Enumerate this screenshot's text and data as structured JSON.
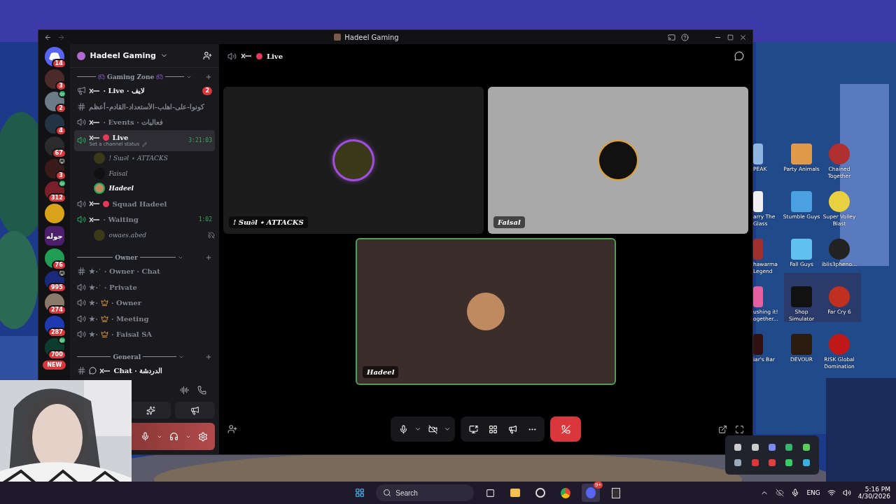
{
  "window": {
    "title": "Hadeel Gaming"
  },
  "servers": [
    {
      "kind": "home",
      "badge": "14"
    },
    {
      "kind": "avatar",
      "badge": "3"
    },
    {
      "kind": "avatar",
      "badge": "2",
      "in_voice": true
    },
    {
      "kind": "avatar",
      "badge": "4"
    },
    {
      "kind": "avatar",
      "badge": "67"
    },
    {
      "kind": "avatar",
      "badge": "3",
      "streaming": true
    },
    {
      "kind": "avatar",
      "badge": "312",
      "in_voice": true
    },
    {
      "kind": "avatar"
    },
    {
      "kind": "logo",
      "label": "جوله"
    },
    {
      "kind": "avatar",
      "badge": "76"
    },
    {
      "kind": "avatar",
      "badge": "995",
      "streaming": true
    },
    {
      "kind": "avatar",
      "badge": "274"
    },
    {
      "kind": "avatar",
      "badge": "287"
    },
    {
      "kind": "avatar",
      "badge": "700",
      "in_voice": true
    }
  ],
  "new_badge": "NEW",
  "sidebar": {
    "server_name": "Hadeel Gaming",
    "categories": [
      {
        "name": "Gaming Zone",
        "gamepads": true,
        "channels": [
          {
            "kind": "announcement",
            "ornament": true,
            "name": "· Live · لايف",
            "unread": true,
            "badge": "2",
            "selected": false
          },
          {
            "kind": "text",
            "name": "كونوا-على-اهلب-الأستعداد-القادم-أعظم",
            "unread": false,
            "selected": false
          },
          {
            "kind": "voice",
            "ornament": true,
            "name": "· Events · فعاليات",
            "unread": false,
            "selected": false
          },
          {
            "kind": "voice",
            "ornament": true,
            "live_dot": true,
            "name": "Live",
            "unread": true,
            "selected": true,
            "active": true,
            "timer": "3:21:03",
            "status": "Set a channel status",
            "users": [
              {
                "name": "! Sɯ∂l ⋆ ATTACKS",
                "speaking": false
              },
              {
                "name": "Faisal",
                "speaking": false
              },
              {
                "name": "Hadeel",
                "speaking": true
              }
            ]
          },
          {
            "kind": "voice",
            "ornament": true,
            "live_dot": true,
            "name": "Squad Hadeel",
            "unread": false,
            "selected": false
          },
          {
            "kind": "voice",
            "ornament": true,
            "name": "· Waiting",
            "unread": false,
            "selected": false,
            "active": true,
            "timer": "1:02",
            "users": [
              {
                "name": "owaes.abed",
                "speaking": false,
                "deafened": true
              }
            ]
          }
        ]
      },
      {
        "name": "Owner",
        "channels": [
          {
            "kind": "text",
            "prefix": "★·˙",
            "name": "· Owner · Chat",
            "unread": false,
            "selected": false
          },
          {
            "kind": "voice",
            "prefix": "★·˙",
            "name": "· Private",
            "unread": false,
            "selected": false
          },
          {
            "kind": "voice",
            "prefix": "★·",
            "crown": true,
            "name": "· Owner",
            "unread": false,
            "selected": false
          },
          {
            "kind": "voice",
            "prefix": "★·",
            "crown": true,
            "name": "· Meeting",
            "unread": false,
            "selected": false
          },
          {
            "kind": "voice",
            "prefix": "★·",
            "crown": true,
            "name": "· Faisal SA",
            "unread": false,
            "selected": false
          }
        ]
      },
      {
        "name": "General",
        "channels": [
          {
            "kind": "text",
            "bubble": true,
            "ornament": true,
            "name": "Chat · الدردشة",
            "unread": true,
            "selected": false
          }
        ]
      }
    ]
  },
  "call": {
    "channel": "Live",
    "tiles": [
      {
        "name": "! Sɯ∂l ⋆ ATTACKS",
        "speaking": false
      },
      {
        "name": "Faisal",
        "speaking": false
      },
      {
        "name": "Hadeel",
        "speaking": true
      }
    ],
    "mic_on": true,
    "camera_on": false
  },
  "desktop_icons": [
    {
      "label": "PEAK"
    },
    {
      "label": "Party Animals"
    },
    {
      "label": "Chained Together"
    },
    {
      "label": "arry The Glass"
    },
    {
      "label": "Stumble Guys"
    },
    {
      "label": "Super Volley Blast"
    },
    {
      "label": "hawarma Legend"
    },
    {
      "label": "Fall Guys"
    },
    {
      "label": "iblis3pheno..."
    },
    {
      "label": "ushing it! ogether..."
    },
    {
      "label": "Shop Simulator"
    },
    {
      "label": "Far Cry 6"
    },
    {
      "label": "iar's Bar"
    },
    {
      "label": "DEVOUR"
    },
    {
      "label": "RISK Global Domination"
    }
  ],
  "taskbar": {
    "search": {
      "placeholder": "Search"
    },
    "discord_badge": "9+",
    "language": "ENG",
    "time": "5:16 PM",
    "date": "4/30/2026"
  }
}
